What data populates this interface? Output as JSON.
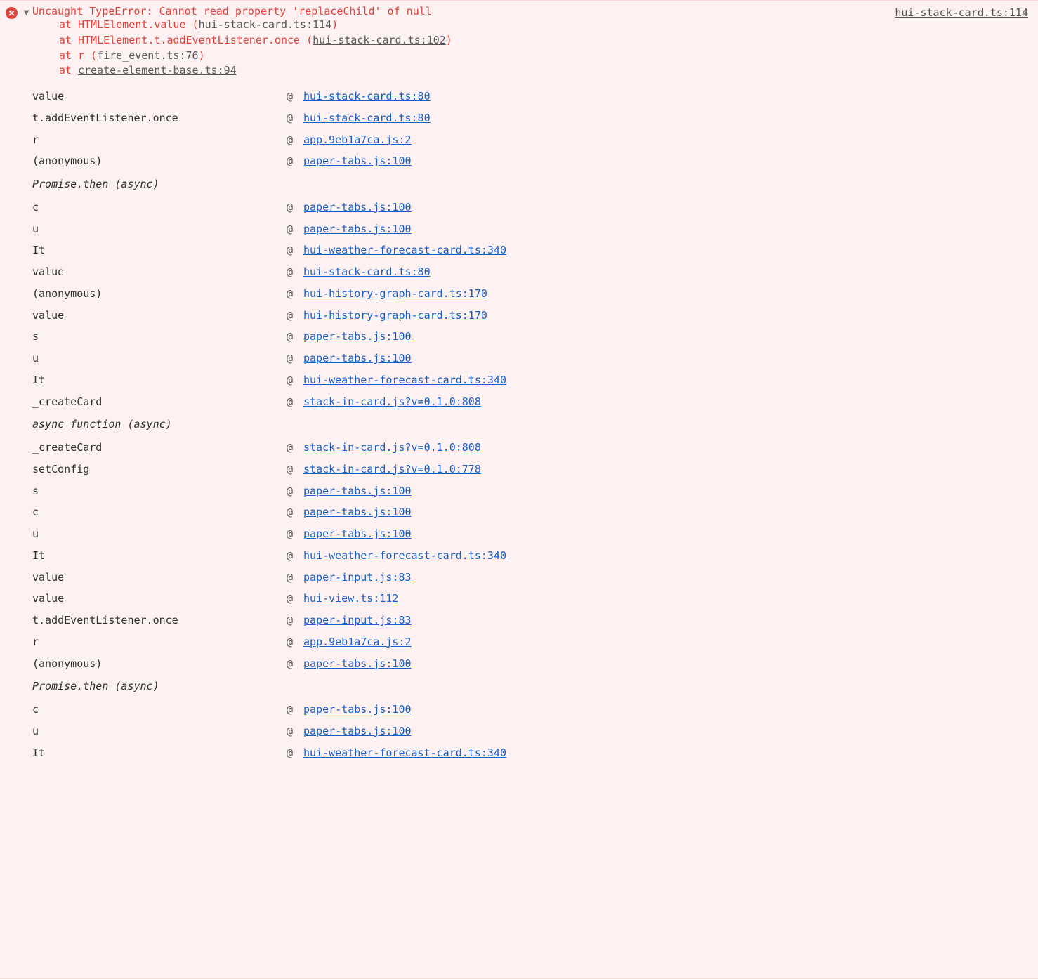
{
  "error": {
    "message": "Uncaught TypeError: Cannot read property 'replaceChild' of null",
    "source_link": "hui-stack-card.ts:114",
    "at_word": "at",
    "stack_at": [
      {
        "fn": "HTMLElement.value",
        "loc": "hui-stack-card.ts:114",
        "parens": true
      },
      {
        "fn": "HTMLElement.t.addEventListener.once",
        "loc": "hui-stack-card.ts:102",
        "parens": true
      },
      {
        "fn": "r",
        "loc": "fire_event.ts:76",
        "parens": true
      },
      {
        "fn": "",
        "loc": "create-element-base.ts:94",
        "parens": false
      }
    ]
  },
  "trace": [
    {
      "type": "row",
      "fn": "value",
      "loc": "hui-stack-card.ts:80"
    },
    {
      "type": "row",
      "fn": "t.addEventListener.once",
      "loc": "hui-stack-card.ts:80"
    },
    {
      "type": "row",
      "fn": "r",
      "loc": "app.9eb1a7ca.js:2"
    },
    {
      "type": "row",
      "fn": "(anonymous)",
      "loc": "paper-tabs.js:100"
    },
    {
      "type": "group",
      "label": "Promise.then (async)"
    },
    {
      "type": "row",
      "fn": "c",
      "loc": "paper-tabs.js:100"
    },
    {
      "type": "row",
      "fn": "u",
      "loc": "paper-tabs.js:100"
    },
    {
      "type": "row",
      "fn": "It",
      "loc": "hui-weather-forecast-card.ts:340"
    },
    {
      "type": "row",
      "fn": "value",
      "loc": "hui-stack-card.ts:80"
    },
    {
      "type": "row",
      "fn": "(anonymous)",
      "loc": "hui-history-graph-card.ts:170"
    },
    {
      "type": "row",
      "fn": "value",
      "loc": "hui-history-graph-card.ts:170"
    },
    {
      "type": "row",
      "fn": "s",
      "loc": "paper-tabs.js:100"
    },
    {
      "type": "row",
      "fn": "u",
      "loc": "paper-tabs.js:100"
    },
    {
      "type": "row",
      "fn": "It",
      "loc": "hui-weather-forecast-card.ts:340"
    },
    {
      "type": "row",
      "fn": "_createCard",
      "loc": "stack-in-card.js?v=0.1.0:808"
    },
    {
      "type": "group",
      "label": "async function (async)"
    },
    {
      "type": "row",
      "fn": "_createCard",
      "loc": "stack-in-card.js?v=0.1.0:808"
    },
    {
      "type": "row",
      "fn": "setConfig",
      "loc": "stack-in-card.js?v=0.1.0:778"
    },
    {
      "type": "row",
      "fn": "s",
      "loc": "paper-tabs.js:100"
    },
    {
      "type": "row",
      "fn": "c",
      "loc": "paper-tabs.js:100"
    },
    {
      "type": "row",
      "fn": "u",
      "loc": "paper-tabs.js:100"
    },
    {
      "type": "row",
      "fn": "It",
      "loc": "hui-weather-forecast-card.ts:340"
    },
    {
      "type": "row",
      "fn": "value",
      "loc": "paper-input.js:83"
    },
    {
      "type": "row",
      "fn": "value",
      "loc": "hui-view.ts:112"
    },
    {
      "type": "row",
      "fn": "t.addEventListener.once",
      "loc": "paper-input.js:83"
    },
    {
      "type": "row",
      "fn": "r",
      "loc": "app.9eb1a7ca.js:2"
    },
    {
      "type": "row",
      "fn": "(anonymous)",
      "loc": "paper-tabs.js:100"
    },
    {
      "type": "group",
      "label": "Promise.then (async)"
    },
    {
      "type": "row",
      "fn": "c",
      "loc": "paper-tabs.js:100"
    },
    {
      "type": "row",
      "fn": "u",
      "loc": "paper-tabs.js:100"
    },
    {
      "type": "row",
      "fn": "It",
      "loc": "hui-weather-forecast-card.ts:340"
    }
  ],
  "at_symbol": "@"
}
